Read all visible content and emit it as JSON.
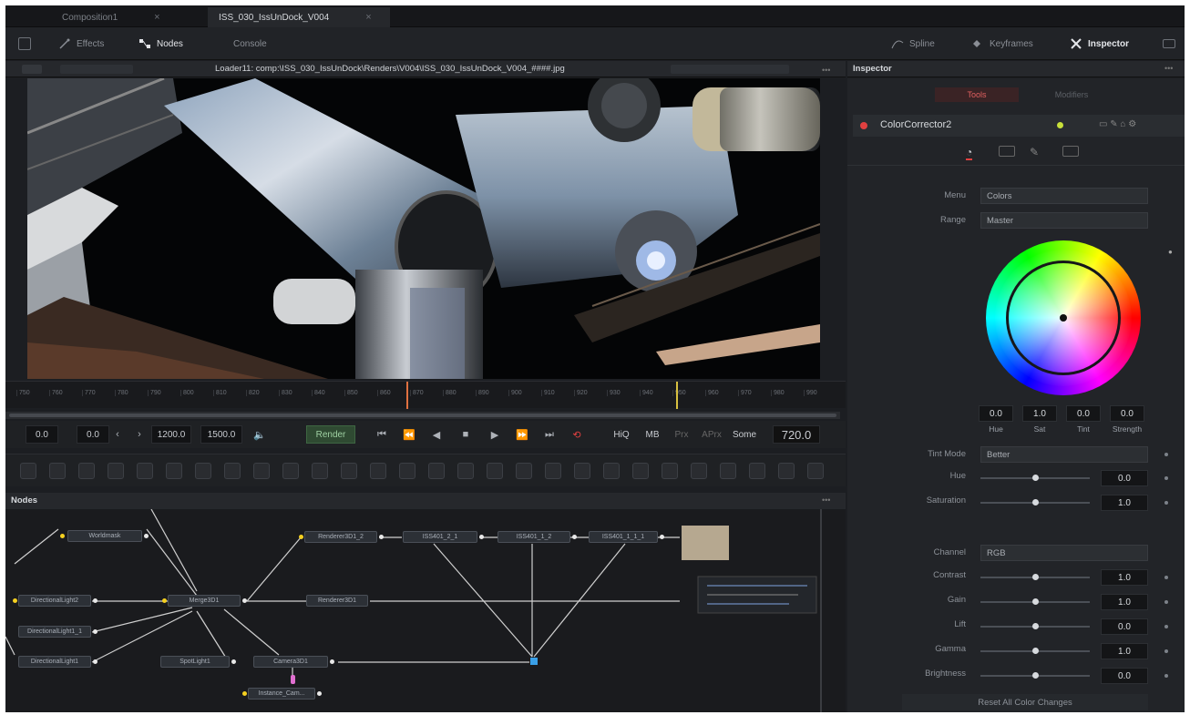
{
  "tabs": [
    {
      "label": "Composition1"
    },
    {
      "label": "ISS_030_IssUnDock_V004"
    }
  ],
  "toolbar": {
    "effects": "Effects",
    "nodes": "Nodes",
    "console": "Console",
    "spline": "Spline",
    "keyframes": "Keyframes",
    "inspector": "Inspector"
  },
  "viewer": {
    "title": "Loader11: comp:\\ISS_030_IssUnDock\\Renders\\V004\\ISS_030_IssUnDock_V004_####.jpg"
  },
  "timeline": {
    "ticks": [
      "750",
      "760",
      "770",
      "780",
      "790",
      "800",
      "810",
      "820",
      "830",
      "840",
      "850",
      "860",
      "870",
      "880",
      "890",
      "900",
      "910",
      "920",
      "930",
      "940",
      "950",
      "960",
      "970",
      "980",
      "990"
    ],
    "current_frame": "720.0"
  },
  "transport": {
    "start": "0.0",
    "render_start": "0.0",
    "render_end": "1200.0",
    "end": "1500.0",
    "render_label": "Render",
    "hiq": "HiQ",
    "mb": "MB",
    "prx": "Prx",
    "aprx": "APrx",
    "some": "Some"
  },
  "nodes_panel": {
    "title": "Nodes",
    "nodes": [
      "Worldmask",
      "DirectionalLight2",
      "DirectionalLight1_1",
      "DirectionalLight1",
      "Merge3D1",
      "SpotLight1",
      "Camera3D1",
      "Renderer3D1_2",
      "Renderer3D1",
      "ISS401_2_1",
      "ISS401_1_2",
      "ISS401_1_1_1",
      "Instance_Cam..."
    ]
  },
  "inspector": {
    "title": "Inspector",
    "tab_tools": "Tools",
    "tab_modifiers": "Modifiers",
    "node_name": "ColorCorrector2",
    "menu_label": "Menu",
    "menu_value": "Colors",
    "range_label": "Range",
    "range_value": "Master",
    "wheel": {
      "hue": "0.0",
      "sat": "1.0",
      "tint": "0.0",
      "strength": "0.0",
      "hue_l": "Hue",
      "sat_l": "Sat",
      "tint_l": "Tint",
      "strength_l": "Strength"
    },
    "tint_mode_label": "Tint Mode",
    "tint_mode_value": "Better",
    "hue_label": "Hue",
    "hue_value": "0.0",
    "saturation_label": "Saturation",
    "saturation_value": "1.0",
    "channel_label": "Channel",
    "channel_value": "RGB",
    "contrast_label": "Contrast",
    "contrast_value": "1.0",
    "gain_label": "Gain",
    "gain_value": "1.0",
    "lift_label": "Lift",
    "lift_value": "0.0",
    "gamma_label": "Gamma",
    "gamma_value": "1.0",
    "brightness_label": "Brightness",
    "brightness_value": "0.0",
    "reset_label": "Reset All Color Changes"
  },
  "colors": {
    "accent_yellow": "#f5d020",
    "active_red": "#e04040",
    "bg": "#1c1e22"
  }
}
